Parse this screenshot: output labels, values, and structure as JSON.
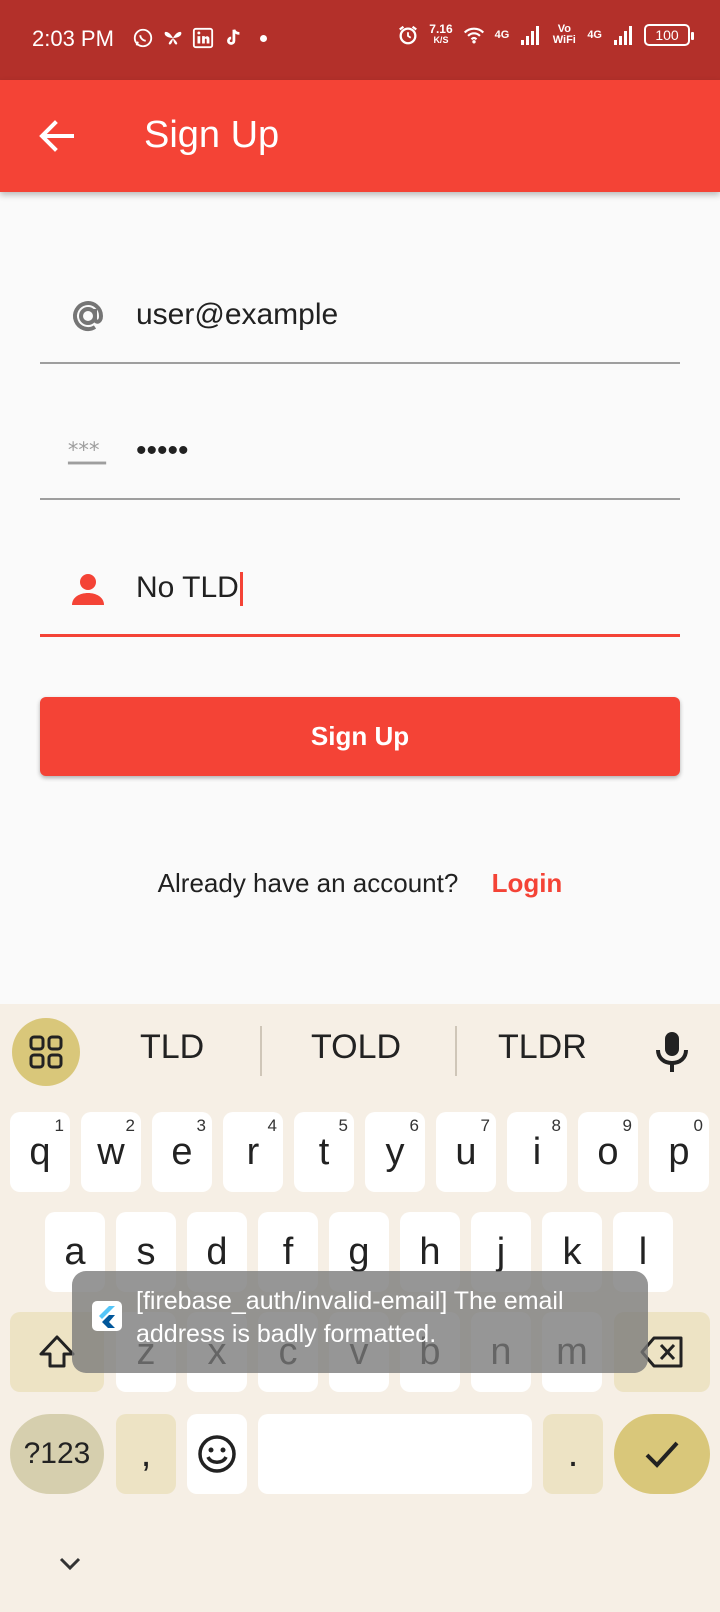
{
  "status_bar": {
    "time": "2:03 PM",
    "speed_value": "7.16",
    "speed_unit": "K/S",
    "net_1": "4G",
    "vowifi": "Vo WiFi",
    "net_2": "4G",
    "battery": "100",
    "left_icons": [
      "whatsapp-icon",
      "butterfly-icon",
      "linkedin-icon",
      "tiktok-icon"
    ]
  },
  "app_bar": {
    "title": "Sign Up"
  },
  "form": {
    "email": {
      "value": "user@example",
      "icon": "at-icon"
    },
    "password": {
      "value": "•••••",
      "icon": "password-icon"
    },
    "name": {
      "value": "No TLD",
      "icon": "person-icon"
    }
  },
  "signup_button": "Sign Up",
  "login_row": {
    "question": "Already have an account?",
    "link": "Login"
  },
  "keyboard": {
    "suggestions": [
      "TLD",
      "TOLD",
      "TLDR"
    ],
    "row1": [
      {
        "k": "q",
        "n": "1"
      },
      {
        "k": "w",
        "n": "2"
      },
      {
        "k": "e",
        "n": "3"
      },
      {
        "k": "r",
        "n": "4"
      },
      {
        "k": "t",
        "n": "5"
      },
      {
        "k": "y",
        "n": "6"
      },
      {
        "k": "u",
        "n": "7"
      },
      {
        "k": "i",
        "n": "8"
      },
      {
        "k": "o",
        "n": "9"
      },
      {
        "k": "p",
        "n": "0"
      }
    ],
    "row2": [
      "a",
      "s",
      "d",
      "f",
      "g",
      "h",
      "j",
      "k",
      "l"
    ],
    "row3": [
      "z",
      "x",
      "c",
      "v",
      "b",
      "n",
      "m"
    ],
    "symbols_key": "?123",
    "comma_key": ",",
    "period_key": "."
  },
  "toast": {
    "message": "[firebase_auth/invalid-email] The email address is badly formatted."
  },
  "colors": {
    "status_bar": "#b3302a",
    "primary": "#f44336",
    "keyboard_bg": "#f6efe5",
    "accent_key": "#d9c77a"
  }
}
